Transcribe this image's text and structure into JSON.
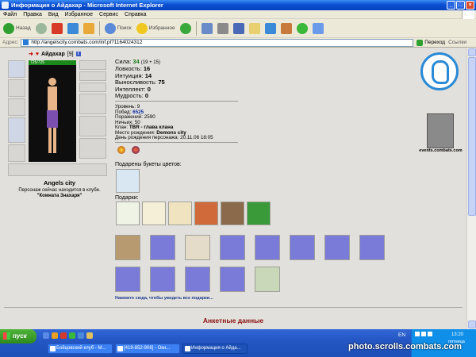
{
  "window": {
    "title": "Информация о Айдахар - Microsoft Internet Explorer",
    "buttons": [
      "_",
      "□",
      "×"
    ]
  },
  "menu": [
    "Файл",
    "Правка",
    "Вид",
    "Избранное",
    "Сервис",
    "Справка"
  ],
  "toolbar": {
    "back": "Назад",
    "search": "Поиск",
    "favorites": "Избранное"
  },
  "address": {
    "label": "Адрес:",
    "url": "http://angelscity.combats.com/inf.pl?1164024312",
    "go": "Переход",
    "links": "Ссылки"
  },
  "character": {
    "name": "Айдахар",
    "level": "[9]",
    "hp": "725/725",
    "city": "Angels city",
    "location_line1": "Персонаж сейчас находится в клубе.",
    "location_line2": "\"Комната Знахаря\""
  },
  "stats": {
    "strength_label": "Сила:",
    "strength": "34",
    "strength_bonus": "(19 + 15)",
    "agility_label": "Ловкость:",
    "agility": "16",
    "intuition_label": "Интуиция:",
    "intuition": "14",
    "endurance_label": "Выносливость:",
    "endurance": "75",
    "intellect_label": "Интеллект:",
    "intellect": "0",
    "wisdom_label": "Мудрость:",
    "wisdom": "0"
  },
  "info": {
    "level_label": "Уровень:",
    "level": "9",
    "wins_label": "Побед:",
    "wins": "6525",
    "losses_label": "Поражений:",
    "losses": "2590",
    "draws_label": "Ничьих:",
    "draws": "50",
    "clan_label": "Клан:",
    "clan": "TBR",
    "clan_role": "- глава клана",
    "birthplace_label": "Место рождения:",
    "birthplace": "Demons city",
    "birthday_label": "День рождения персонажа:",
    "birthday": "20.11.06 18:05"
  },
  "sections": {
    "flowers": "Подарены букеты цветов:",
    "gifts": "Подарки:",
    "see_all": "Нажмите сюда, чтобы увидеть все подарки...",
    "anketa": "Анкетные данные"
  },
  "logos": {
    "events": "events.combats.com"
  },
  "colors": {
    "title_bar": "#0a4fd1",
    "stat_green": "#1a7a1a",
    "anketa_red": "#8a1010",
    "link_blue": "#1a3a90"
  },
  "taskbar": {
    "start": "пуск",
    "tasks": [
      "Бойцовский клуб - M...",
      "[419-852-906] - Окн...",
      "Информация о Айда..."
    ],
    "lang": "EN",
    "time": "13:20",
    "day": "пятница"
  },
  "watermark": "photo.scrolls.combats.com"
}
